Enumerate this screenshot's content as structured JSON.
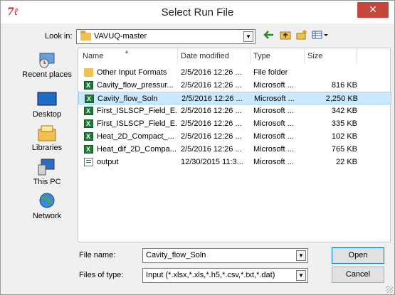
{
  "window": {
    "title": "Select Run File",
    "app_icon_text": "7ℓ",
    "close_glyph": "✕"
  },
  "lookin": {
    "label": "Look in:",
    "value": "VAVUQ-master",
    "toolbar_icons": [
      "back-arrow-icon",
      "up-folder-icon",
      "new-folder-icon",
      "view-menu-icon"
    ]
  },
  "places": [
    {
      "label": "Recent places",
      "icon": "recent-places-icon"
    },
    {
      "label": "Desktop",
      "icon": "desktop-icon"
    },
    {
      "label": "Libraries",
      "icon": "libraries-icon"
    },
    {
      "label": "This PC",
      "icon": "this-pc-icon"
    },
    {
      "label": "Network",
      "icon": "network-icon"
    }
  ],
  "columns": {
    "name": "Name",
    "date": "Date modified",
    "type": "Type",
    "size": "Size"
  },
  "files": [
    {
      "name": "Other Input Formats",
      "date": "2/5/2016 12:26 ...",
      "type": "File folder",
      "size": "",
      "icon": "folder"
    },
    {
      "name": "Cavity_flow_pressur...",
      "date": "2/5/2016 12:26 ...",
      "type": "Microsoft ...",
      "size": "816 KB",
      "icon": "xls"
    },
    {
      "name": "Cavity_flow_Soln",
      "date": "2/5/2016 12:26 ...",
      "type": "Microsoft ...",
      "size": "2,250 KB",
      "icon": "xls",
      "selected": true
    },
    {
      "name": "First_ISLSCP_Field_E...",
      "date": "2/5/2016 12:26 ...",
      "type": "Microsoft ...",
      "size": "342 KB",
      "icon": "xls"
    },
    {
      "name": "First_ISLSCP_Field_E...",
      "date": "2/5/2016 12:26 ...",
      "type": "Microsoft ...",
      "size": "335 KB",
      "icon": "xls"
    },
    {
      "name": "Heat_2D_Compact_...",
      "date": "2/5/2016 12:26 ...",
      "type": "Microsoft ...",
      "size": "102 KB",
      "icon": "xls"
    },
    {
      "name": "Heat_dif_2D_Compa...",
      "date": "2/5/2016 12:26 ...",
      "type": "Microsoft ...",
      "size": "765 KB",
      "icon": "xls"
    },
    {
      "name": "output",
      "date": "12/30/2015 11:3...",
      "type": "Microsoft ...",
      "size": "22 KB",
      "icon": "plain"
    }
  ],
  "filename": {
    "label": "File name:",
    "value": "Cavity_flow_Soln"
  },
  "filetype": {
    "label": "Files of type:",
    "value": "Input (*.xlsx,*.xls,*.h5,*.csv,*.txt,*.dat)"
  },
  "buttons": {
    "open": "Open",
    "cancel": "Cancel"
  },
  "colors": {
    "selection": "#cce8ff",
    "close_button": "#c7463c"
  }
}
